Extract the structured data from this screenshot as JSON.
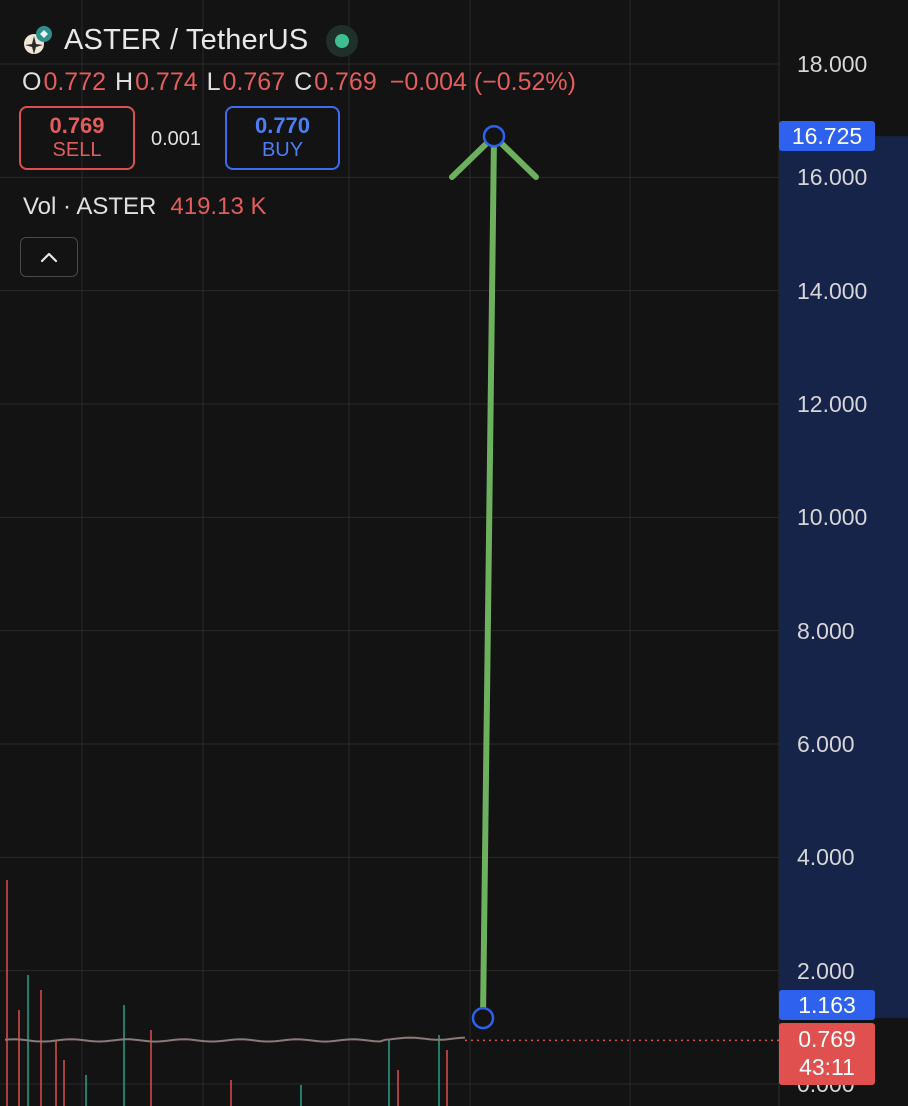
{
  "header": {
    "pair_title": "ASTER / TetherUS",
    "status_color": "#3fbf8f"
  },
  "ohlc": {
    "o_label": "O",
    "o_value": "0.772",
    "h_label": "H",
    "h_value": "0.774",
    "l_label": "L",
    "l_value": "0.767",
    "c_label": "C",
    "c_value": "0.769",
    "change": "−0.004 (−0.52%)"
  },
  "trade": {
    "sell_price": "0.769",
    "sell_label": "SELL",
    "spread": "0.001",
    "buy_price": "0.770",
    "buy_label": "BUY"
  },
  "volume": {
    "label": "Vol · ASTER",
    "value": "419.13 K"
  },
  "axis": {
    "ticks": [
      "18.000",
      "16.000",
      "14.000",
      "12.000",
      "10.000",
      "8.000",
      "6.000",
      "4.000",
      "2.000",
      "0.000"
    ],
    "tick_values": [
      18,
      16,
      14,
      12,
      10,
      8,
      6,
      4,
      2,
      0
    ]
  },
  "tags": {
    "top_price": "16.725",
    "bottom_price": "1.163",
    "last_price": "0.769",
    "countdown": "43:11"
  },
  "chart_data": {
    "type": "line",
    "ylim": [
      0,
      18
    ],
    "last_price": 0.769,
    "arrow": {
      "from_price": 1.163,
      "to_price": 16.725
    },
    "range_band": [
      1.163,
      16.725
    ]
  },
  "colors": {
    "background": "#131313",
    "grid": "#2a2a2a",
    "arrow": "#6db05d",
    "handle": "#2e62ee",
    "band": "#17244a",
    "down": "#e0504f",
    "up": "#2aa18a"
  }
}
